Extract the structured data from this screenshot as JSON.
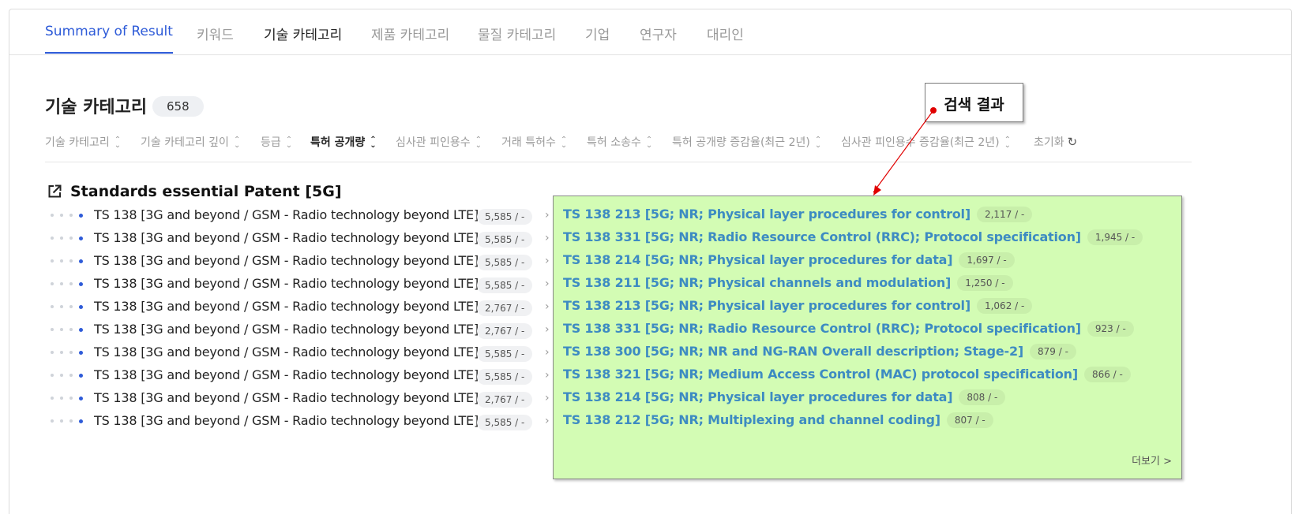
{
  "tabs": [
    {
      "label": "Summary of Result"
    },
    {
      "label": "키워드"
    },
    {
      "label": "기술 카테고리"
    },
    {
      "label": "제품 카테고리"
    },
    {
      "label": "물질 카테고리"
    },
    {
      "label": "기업"
    },
    {
      "label": "연구자"
    },
    {
      "label": "대리인"
    }
  ],
  "section": {
    "title": "기술 카테고리",
    "count": "658"
  },
  "sort_options": [
    {
      "label": "기술 카테고리"
    },
    {
      "label": "기술 카테고리 깊이"
    },
    {
      "label": "등급"
    },
    {
      "label": "특허 공개량"
    },
    {
      "label": "심사관 피인용수"
    },
    {
      "label": "거래 특허수"
    },
    {
      "label": "특허 소송수"
    },
    {
      "label": "특허 공개량 증감율(최근 2년)"
    },
    {
      "label": "심사관 피인용수 증감율(최근 2년)"
    }
  ],
  "reset_label": "초기화",
  "group": {
    "title": "Standards essential Patent [5G]"
  },
  "left_rows": [
    {
      "name": "TS 138 [3G and beyond / GSM - Radio technology beyond LTE]",
      "badge": "5,585 / -"
    },
    {
      "name": "TS 138 [3G and beyond / GSM - Radio technology beyond LTE]",
      "badge": "5,585 / -"
    },
    {
      "name": "TS 138 [3G and beyond / GSM - Radio technology beyond LTE]",
      "badge": "5,585 / -"
    },
    {
      "name": "TS 138 [3G and beyond / GSM - Radio technology beyond LTE]",
      "badge": "5,585 / -"
    },
    {
      "name": "TS 138 [3G and beyond / GSM - Radio technology beyond LTE]",
      "badge": "2,767 / -"
    },
    {
      "name": "TS 138 [3G and beyond / GSM - Radio technology beyond LTE]",
      "badge": "2,767 / -"
    },
    {
      "name": "TS 138 [3G and beyond / GSM - Radio technology beyond LTE]",
      "badge": "5,585 / -"
    },
    {
      "name": "TS 138 [3G and beyond / GSM - Radio technology beyond LTE]",
      "badge": "5,585 / -"
    },
    {
      "name": "TS 138 [3G and beyond / GSM - Radio technology beyond LTE]",
      "badge": "2,767 / -"
    },
    {
      "name": "TS 138 [3G and beyond / GSM - Radio technology beyond LTE]",
      "badge": "5,585 / -"
    }
  ],
  "right_rows": [
    {
      "name": "TS 138 213 [5G; NR; Physical layer procedures for control]",
      "badge": "2,117 / -"
    },
    {
      "name": "TS 138 331 [5G; NR; Radio Resource Control (RRC); Protocol specification]",
      "badge": "1,945 / -"
    },
    {
      "name": "TS 138 214 [5G; NR; Physical layer procedures for data]",
      "badge": "1,697 / -"
    },
    {
      "name": "TS 138 211 [5G; NR; Physical channels and modulation]",
      "badge": "1,250 / -"
    },
    {
      "name": "TS 138 213 [5G; NR; Physical layer procedures for control]",
      "badge": "1,062 / -"
    },
    {
      "name": "TS 138 331 [5G; NR; Radio Resource Control (RRC); Protocol specification]",
      "badge": "923 / -"
    },
    {
      "name": "TS 138 300 [5G; NR; NR and NG-RAN Overall description; Stage-2]",
      "badge": "879 / -"
    },
    {
      "name": "TS 138 321 [5G; NR; Medium Access Control (MAC) protocol specification]",
      "badge": "866 / -"
    },
    {
      "name": "TS 138 214 [5G; NR; Physical layer procedures for data]",
      "badge": "808 / -"
    },
    {
      "name": "TS 138 212 [5G; NR; Multiplexing and channel coding]",
      "badge": "807 / -"
    }
  ],
  "more_label": "더보기 >",
  "callout": {
    "label": "검색 결과"
  },
  "colors": {
    "accent": "#2e5bd8",
    "highlight": "#d3fcb4",
    "link": "#3d8bc2",
    "annotation": "#e00000"
  },
  "icons": {
    "group": "external-link-icon",
    "reset": "refresh-icon",
    "sort": "sort-updown-icon",
    "chevron": "chevron-right-icon"
  }
}
